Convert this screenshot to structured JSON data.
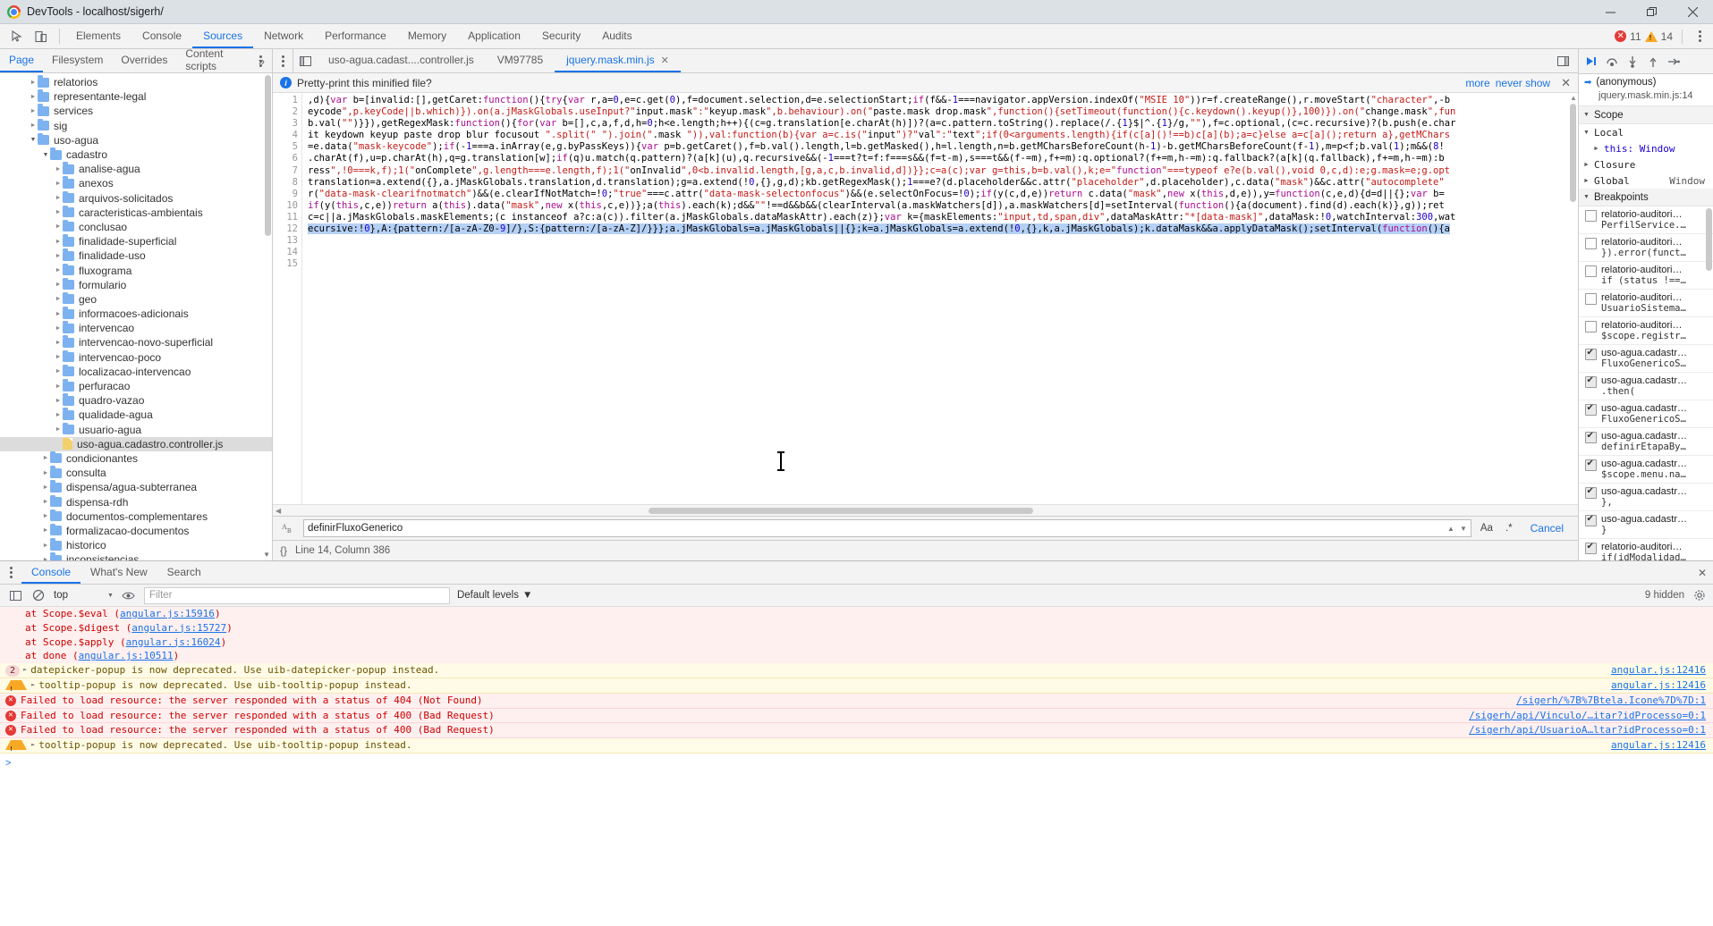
{
  "window": {
    "title": "DevTools - localhost/sigerh/",
    "minimize": "minimize-icon",
    "restore": "restore-icon",
    "close": "close-icon"
  },
  "toolbar": {
    "inspect_icon": "inspect-cursor-icon",
    "device_icon": "device-toolbar-icon",
    "tabs": [
      {
        "label": "Elements",
        "active": false
      },
      {
        "label": "Console",
        "active": false
      },
      {
        "label": "Sources",
        "active": true
      },
      {
        "label": "Network",
        "active": false
      },
      {
        "label": "Performance",
        "active": false
      },
      {
        "label": "Memory",
        "active": false
      },
      {
        "label": "Application",
        "active": false
      },
      {
        "label": "Security",
        "active": false
      },
      {
        "label": "Audits",
        "active": false
      }
    ],
    "error_count": "11",
    "warning_count": "14",
    "menu_icon": "kebab-menu-icon"
  },
  "navigator": {
    "tabs": [
      {
        "label": "Page",
        "active": true
      },
      {
        "label": "Filesystem",
        "active": false
      },
      {
        "label": "Overrides",
        "active": false
      },
      {
        "label": "Content scripts",
        "active": false
      }
    ],
    "more": "»",
    "tree": [
      {
        "label": "relatorios",
        "indent": 1,
        "type": "folder",
        "state": "closed"
      },
      {
        "label": "representante-legal",
        "indent": 1,
        "type": "folder",
        "state": "closed"
      },
      {
        "label": "services",
        "indent": 1,
        "type": "folder",
        "state": "closed"
      },
      {
        "label": "sig",
        "indent": 1,
        "type": "folder",
        "state": "closed"
      },
      {
        "label": "uso-agua",
        "indent": 1,
        "type": "folder",
        "state": "open"
      },
      {
        "label": "cadastro",
        "indent": 2,
        "type": "folder",
        "state": "open"
      },
      {
        "label": "analise-agua",
        "indent": 3,
        "type": "folder",
        "state": "closed"
      },
      {
        "label": "anexos",
        "indent": 3,
        "type": "folder",
        "state": "closed"
      },
      {
        "label": "arquivos-solicitados",
        "indent": 3,
        "type": "folder",
        "state": "closed"
      },
      {
        "label": "caracteristicas-ambientais",
        "indent": 3,
        "type": "folder",
        "state": "closed"
      },
      {
        "label": "conclusao",
        "indent": 3,
        "type": "folder",
        "state": "closed"
      },
      {
        "label": "finalidade-superficial",
        "indent": 3,
        "type": "folder",
        "state": "closed"
      },
      {
        "label": "finalidade-uso",
        "indent": 3,
        "type": "folder",
        "state": "closed"
      },
      {
        "label": "fluxograma",
        "indent": 3,
        "type": "folder",
        "state": "closed"
      },
      {
        "label": "formulario",
        "indent": 3,
        "type": "folder",
        "state": "closed"
      },
      {
        "label": "geo",
        "indent": 3,
        "type": "folder",
        "state": "closed"
      },
      {
        "label": "informacoes-adicionais",
        "indent": 3,
        "type": "folder",
        "state": "closed"
      },
      {
        "label": "intervencao",
        "indent": 3,
        "type": "folder",
        "state": "closed"
      },
      {
        "label": "intervencao-novo-superficial",
        "indent": 3,
        "type": "folder",
        "state": "closed"
      },
      {
        "label": "intervencao-poco",
        "indent": 3,
        "type": "folder",
        "state": "closed"
      },
      {
        "label": "localizacao-intervencao",
        "indent": 3,
        "type": "folder",
        "state": "closed"
      },
      {
        "label": "perfuracao",
        "indent": 3,
        "type": "folder",
        "state": "closed"
      },
      {
        "label": "quadro-vazao",
        "indent": 3,
        "type": "folder",
        "state": "closed"
      },
      {
        "label": "qualidade-agua",
        "indent": 3,
        "type": "folder",
        "state": "closed"
      },
      {
        "label": "usuario-agua",
        "indent": 3,
        "type": "folder",
        "state": "closed"
      },
      {
        "label": "uso-agua.cadastro.controller.js",
        "indent": 3,
        "type": "js",
        "state": "none",
        "selected": true
      },
      {
        "label": "condicionantes",
        "indent": 2,
        "type": "folder",
        "state": "closed"
      },
      {
        "label": "consulta",
        "indent": 2,
        "type": "folder",
        "state": "closed"
      },
      {
        "label": "dispensa/agua-subterranea",
        "indent": 2,
        "type": "folder",
        "state": "closed"
      },
      {
        "label": "dispensa-rdh",
        "indent": 2,
        "type": "folder",
        "state": "closed"
      },
      {
        "label": "documentos-complementares",
        "indent": 2,
        "type": "folder",
        "state": "closed"
      },
      {
        "label": "formalizacao-documentos",
        "indent": 2,
        "type": "folder",
        "state": "closed"
      },
      {
        "label": "historico",
        "indent": 2,
        "type": "folder",
        "state": "closed"
      },
      {
        "label": "inconsistencias",
        "indent": 2,
        "type": "folder",
        "state": "closed"
      }
    ]
  },
  "editor": {
    "tabs": [
      {
        "label": "uso-agua.cadast....controller.js",
        "active": false,
        "closable": false
      },
      {
        "label": "VM97785",
        "active": false,
        "closable": false
      },
      {
        "label": "jquery.mask.min.js",
        "active": true,
        "closable": true
      }
    ],
    "close_glyph": "✕",
    "infobar": {
      "message": "Pretty-print this minified file?",
      "more": "more",
      "never_show": "never show",
      "close": "✕"
    },
    "line_numbers": [
      "1",
      "2",
      "3",
      "4",
      "5",
      "6",
      "7",
      "8",
      "9",
      "10",
      "11",
      "12",
      "13",
      "14",
      "15"
    ],
    "lines": [
      "",
      "",
      ",d){var b=[invalid:[],getCaret:function(){try{var r,a=0,e=c.get(0),f=document.selection,d=e.selectionStart;if(f&&-1===navigator.appVersion.indexOf(\"MSIE 10\"))r=f.createRange(),r.moveStart(\"character\",-b",
      "eycode\",p.keyCode||b.which)}).on(a.jMaskGlobals.useInput?\"input.mask\":\"keyup.mask\",b.behaviour).on(\"paste.mask drop.mask\",function(){setTimeout(function(){c.keydown().keyup()},100)}).on(\"change.mask\",fun",
      "b.val(\"\")}}),getRegexMask:function(){for(var b=[],c,a,f,d,h=0;h<e.length;h++){(c=g.translation[e.charAt(h)])?(a=c.pattern.toString().replace(/.{1}$|^.{1}/g,\"\"),f=c.optional,(c=c.recursive)?(b.push(e.char",
      "it keydown keyup paste drop blur focusout \".split(\" \").join(\".mask \")),val:function(b){var a=c.is(\"input\")?\"val\":\"text\";if(0<arguments.length){if(c[a]()!==b)c[a](b);a=c}else a=c[a]();return a},getMChars",
      "=e.data(\"mask-keycode\");if(-1===a.inArray(e,g.byPassKeys)){var p=b.getCaret(),f=b.val().length,l=b.getMasked(),h=l.length,n=b.getMCharsBeforeCount(h-1)-b.getMCharsBeforeCount(f-1),m=p<f;b.val(1);m&&(8!",
      ".charAt(f),u=p.charAt(h),q=g.translation[w];if(q)u.match(q.pattern)?(a[k](u),q.recursive&&(-1===t?t=f:f===s&&(f=t-m),s===t&&(f-=m),f+=m):q.optional?(f+=m,h-=m):q.fallback?(a[k](q.fallback),f+=m,h-=m):b",
      "ress\",!0===k,f);1(\"onComplete\",g.length===e.length,f);1(\"onInvalid\",0<b.invalid.length,[g,a,c,b.invalid,d])}};c=a(c);var g=this,b=b.val(),k;e=\"function\"===typeof e?e(b.val(),void 0,c,d):e;g.mask=e;g.opt",
      "translation=a.extend({},a.jMaskGlobals.translation,d.translation);g=a.extend(!0,{},g,d);kb.getRegexMask();1===e?(d.placeholder&&c.attr(\"placeholder\",d.placeholder),c.data(\"mask\")&&c.attr(\"autocomplete\"",
      "r(\"data-mask-clearifnotmatch\")&&(e.clearIfNotMatch=!0;\"true\"===c.attr(\"data-mask-selectonfocus\")&&(e.selectOnFocus=!0);if(y(c,d,e))return c.data(\"mask\",new x(this,d,e)),y=function(c,e,d){d=d||{};var b=",
      "if(y(this,c,e))return a(this).data(\"mask\",new x(this,c,e))};a(this).each(k);d&&\"\"!==d&&b&&(clearInterval(a.maskWatchers[d]),a.maskWatchers[d]=setInterval(function(){a(document).find(d).each(k)},g));ret",
      "c=c||a.jMaskGlobals.maskElements;(c instanceof a?c:a(c)).filter(a.jMaskGlobals.dataMaskAttr).each(z)};var k={maskElements:\"input,td,span,div\",dataMaskAttr:\"*[data-mask]\",dataMask:!0,watchInterval:300,wat",
      "ecursive:!0},A:{pattern:/[a-zA-Z0-9]/},S:{pattern:/[a-zA-Z]/}}};a.jMaskGlobals=a.jMaskGlobals||{};k=a.jMaskGlobals=a.extend(!0,{},k,a.jMaskGlobals);k.dataMask&&a.applyDataMask();setInterval(function(){a",
      ""
    ],
    "search": {
      "value": "definirFluxoGenerico",
      "match_case": "Aa",
      "regex": ".*",
      "cancel": "Cancel",
      "prev": "▲",
      "next": "▼",
      "icon": "search-case-icon"
    },
    "status": {
      "format_icon": "{}",
      "position": "Line 14, Column 386"
    }
  },
  "debugger": {
    "controls": [
      {
        "name": "resume-script-button",
        "glyph": "▶"
      },
      {
        "name": "step-over-button",
        "glyph": "↷"
      },
      {
        "name": "step-into-button",
        "glyph": "↓"
      },
      {
        "name": "step-out-button",
        "glyph": "↑"
      },
      {
        "name": "step-button",
        "glyph": "→"
      }
    ],
    "call_frame": {
      "name": "(anonymous)",
      "location": "jquery.mask.min.js:14"
    },
    "scope_section": "Scope",
    "scope": [
      {
        "label": "Local",
        "expanded": true,
        "value": ""
      },
      {
        "label": "this: Window",
        "expanded": false,
        "value": "",
        "child": true
      },
      {
        "label": "Closure",
        "expanded": false,
        "value": ""
      },
      {
        "label": "Global",
        "expanded": false,
        "value": "Window"
      }
    ],
    "breakpoints_section": "Breakpoints",
    "breakpoints": [
      {
        "checked": false,
        "file": "relatorio-auditori…",
        "code": "PerfilService.…"
      },
      {
        "checked": false,
        "file": "relatorio-auditori…",
        "code": "}).error(funct…"
      },
      {
        "checked": false,
        "file": "relatorio-auditori…",
        "code": "if (status !==…"
      },
      {
        "checked": false,
        "file": "relatorio-auditori…",
        "code": "UsuarioSistema…"
      },
      {
        "checked": false,
        "file": "relatorio-auditori…",
        "code": "$scope.registr…"
      },
      {
        "checked": true,
        "file": "uso-agua.cadastr…",
        "code": "FluxoGenericoS…"
      },
      {
        "checked": true,
        "file": "uso-agua.cadastr…",
        "code": ".then("
      },
      {
        "checked": true,
        "file": "uso-agua.cadastr…",
        "code": "FluxoGenericoS…"
      },
      {
        "checked": true,
        "file": "uso-agua.cadastr…",
        "code": "definirEtapaBy…"
      },
      {
        "checked": true,
        "file": "uso-agua.cadastr…",
        "code": "$scope.menu.na…"
      },
      {
        "checked": true,
        "file": "uso-agua.cadastr…",
        "code": "},"
      },
      {
        "checked": true,
        "file": "uso-agua.cadastr…",
        "code": "}"
      },
      {
        "checked": true,
        "file": "relatorio-auditori…",
        "code": "if(idModalidad…"
      }
    ]
  },
  "drawer": {
    "tabs": [
      {
        "label": "Console",
        "active": true
      },
      {
        "label": "What's New",
        "active": false
      },
      {
        "label": "Search",
        "active": false
      }
    ],
    "close": "✕",
    "console_bar": {
      "sidebar_icon": "show-console-sidebar-icon",
      "clear_icon": "clear-console-icon",
      "context": "top",
      "context_caret": "▼",
      "eye_icon": "live-expression-icon",
      "filter_placeholder": "Filter",
      "levels": "Default levels",
      "levels_caret": "▼",
      "hidden_count": "9 hidden",
      "settings_icon": "settings-gear-icon"
    },
    "messages": [
      {
        "type": "stack",
        "text": "at Scope.$eval (",
        "link": "angular.js:15916",
        "tail": ")",
        "indent": true
      },
      {
        "type": "stack",
        "text": "at Scope.$digest (",
        "link": "angular.js:15727",
        "tail": ")",
        "indent": true
      },
      {
        "type": "stack",
        "text": "at Scope.$apply (",
        "link": "angular.js:16024",
        "tail": ")",
        "indent": true
      },
      {
        "type": "stack",
        "text": "at done (",
        "link": "angular.js:10511",
        "tail": ")",
        "indent": true
      },
      {
        "type": "warn",
        "count": "2",
        "text": "datepicker-popup is now deprecated. Use uib-datepicker-popup instead.",
        "src": "angular.js:12416"
      },
      {
        "type": "warn",
        "count": "",
        "text": "tooltip-popup is now deprecated. Use uib-tooltip-popup instead.",
        "src": "angular.js:12416"
      },
      {
        "type": "error",
        "count": "",
        "text": "Failed to load resource: the server responded with a status of 404 (Not Found)",
        "src": "/sigerh/%7B%7Btela.Icone%7D%7D:1"
      },
      {
        "type": "error",
        "count": "",
        "text": "Failed to load resource: the server responded with a status of 400 (Bad Request)",
        "src": "/sigerh/api/Vinculo/…itar?idProcesso=0:1"
      },
      {
        "type": "error",
        "count": "",
        "text": "Failed to load resource: the server responded with a status of 400 (Bad Request)",
        "src": "/sigerh/api/UsuarioA…ltar?idProcesso=0:1"
      },
      {
        "type": "warn",
        "count": "",
        "text": "tooltip-popup is now deprecated. Use uib-tooltip-popup instead.",
        "src": "angular.js:12416"
      }
    ],
    "prompt": ">"
  }
}
